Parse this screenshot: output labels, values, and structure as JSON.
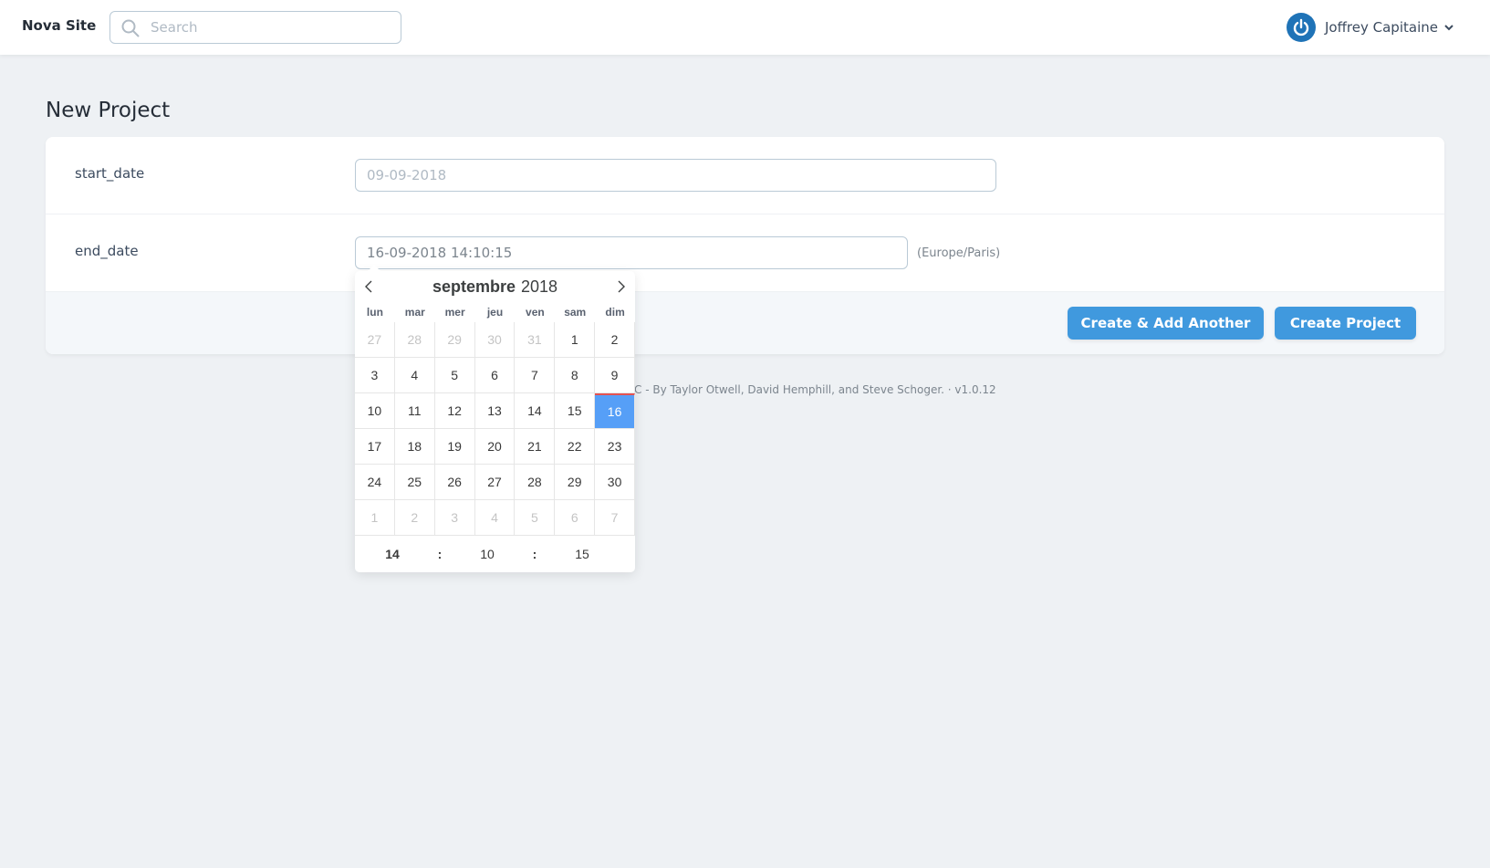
{
  "header": {
    "brand": "Nova Site",
    "search_placeholder": "Search",
    "user_name": "Joffrey Capitaine"
  },
  "page": {
    "title": "New Project"
  },
  "form": {
    "start_date": {
      "label": "start_date",
      "placeholder": "09-09-2018"
    },
    "end_date": {
      "label": "end_date",
      "value": "16-09-2018 14:10:15",
      "timezone": "(Europe/Paris)"
    },
    "buttons": {
      "create_another": "Create & Add Another",
      "create": "Create Project"
    }
  },
  "footer": {
    "text": "vel LLC - By Taylor Otwell, David Hemphill, and Steve Schoger.  ·  v1.0.12"
  },
  "datepicker": {
    "month": "septembre",
    "year": "2018",
    "weekdays": [
      "lun",
      "mar",
      "mer",
      "jeu",
      "ven",
      "sam",
      "dim"
    ],
    "days": [
      {
        "d": "27",
        "other": true
      },
      {
        "d": "28",
        "other": true
      },
      {
        "d": "29",
        "other": true
      },
      {
        "d": "30",
        "other": true
      },
      {
        "d": "31",
        "other": true
      },
      {
        "d": "1"
      },
      {
        "d": "2"
      },
      {
        "d": "3"
      },
      {
        "d": "4"
      },
      {
        "d": "5"
      },
      {
        "d": "6"
      },
      {
        "d": "7"
      },
      {
        "d": "8"
      },
      {
        "d": "9"
      },
      {
        "d": "10"
      },
      {
        "d": "11"
      },
      {
        "d": "12"
      },
      {
        "d": "13"
      },
      {
        "d": "14"
      },
      {
        "d": "15"
      },
      {
        "d": "16",
        "selected": true
      },
      {
        "d": "17"
      },
      {
        "d": "18"
      },
      {
        "d": "19"
      },
      {
        "d": "20"
      },
      {
        "d": "21"
      },
      {
        "d": "22"
      },
      {
        "d": "23"
      },
      {
        "d": "24"
      },
      {
        "d": "25"
      },
      {
        "d": "26"
      },
      {
        "d": "27"
      },
      {
        "d": "28"
      },
      {
        "d": "29"
      },
      {
        "d": "30"
      },
      {
        "d": "1",
        "other": true
      },
      {
        "d": "2",
        "other": true
      },
      {
        "d": "3",
        "other": true
      },
      {
        "d": "4",
        "other": true
      },
      {
        "d": "5",
        "other": true
      },
      {
        "d": "6",
        "other": true
      },
      {
        "d": "7",
        "other": true
      }
    ],
    "time": {
      "hour": "14",
      "minute": "10",
      "second": "15",
      "separator": ":"
    }
  },
  "colors": {
    "accent": "#4099de",
    "selected_day": "#569ff7",
    "avatar": "#1f73b7"
  }
}
